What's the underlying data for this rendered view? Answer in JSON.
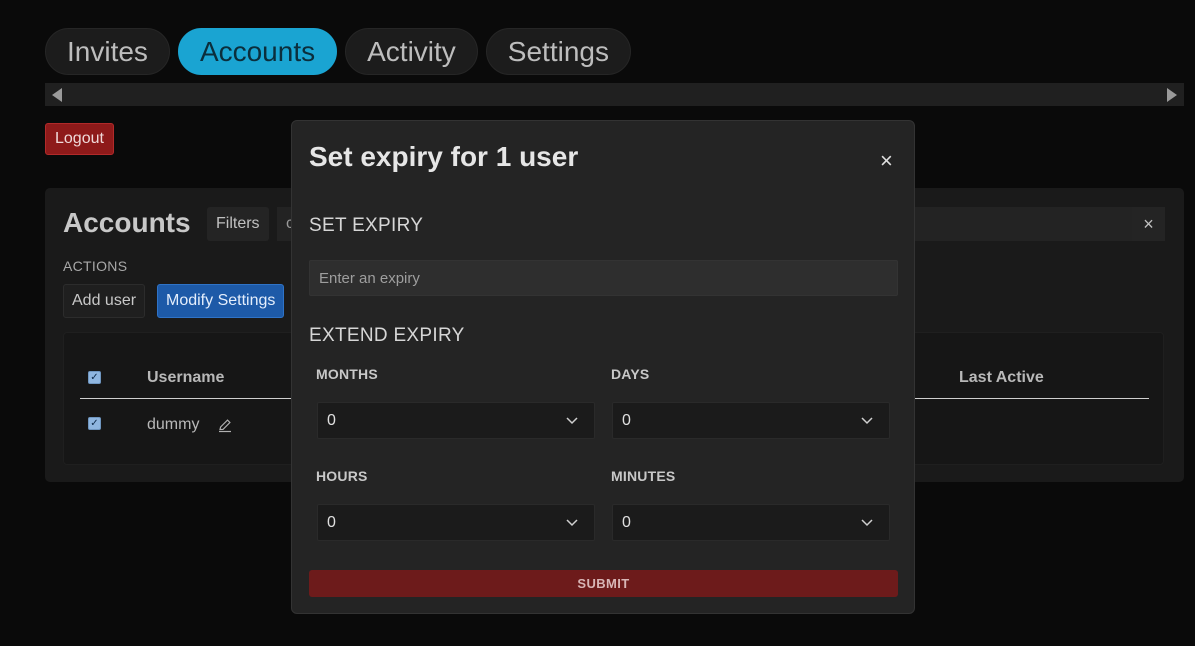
{
  "tabs": [
    {
      "label": "Invites",
      "active": false
    },
    {
      "label": "Accounts",
      "active": true
    },
    {
      "label": "Activity",
      "active": false
    },
    {
      "label": "Settings",
      "active": false
    }
  ],
  "logout_label": "Logout",
  "accounts": {
    "title": "Accounts",
    "filters_label": "Filters",
    "search_value": "c",
    "clear_label": "×",
    "actions_label": "ACTIONS",
    "add_user_label": "Add user",
    "modify_settings_label": "Modify Settings",
    "table": {
      "headers": {
        "username": "Username",
        "last_active": "Last Active"
      },
      "rows": [
        {
          "username": "dummy",
          "selected": true
        }
      ]
    }
  },
  "modal": {
    "title": "Set expiry for 1 user",
    "close_label": "×",
    "set_expiry_heading": "SET EXPIRY",
    "expiry_placeholder": "Enter an expiry",
    "extend_expiry_heading": "EXTEND EXPIRY",
    "fields": {
      "months": {
        "label": "MONTHS",
        "value": "0"
      },
      "days": {
        "label": "DAYS",
        "value": "0"
      },
      "hours": {
        "label": "HOURS",
        "value": "0"
      },
      "minutes": {
        "label": "MINUTES",
        "value": "0"
      }
    },
    "submit_label": "SUBMIT"
  },
  "colors": {
    "accent": "#1aa4d2",
    "danger": "#8e1a1a",
    "primary": "#1d5aa8",
    "background": "#0a0a0a"
  }
}
